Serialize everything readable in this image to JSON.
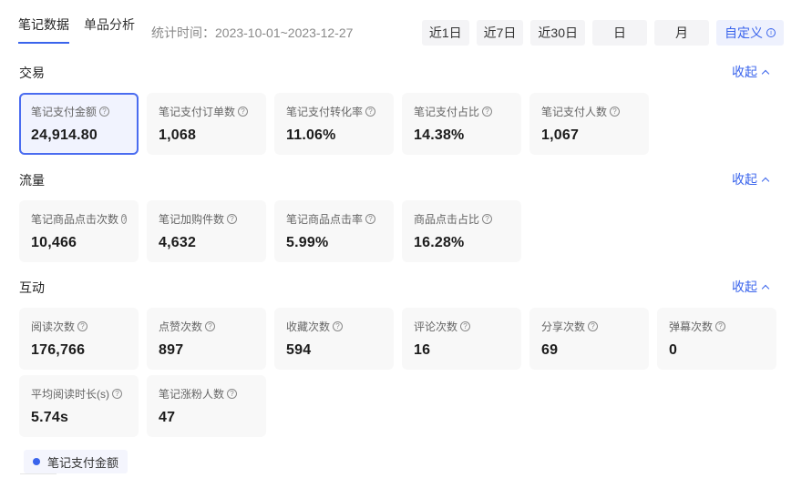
{
  "tabs": [
    {
      "label": "笔记数据",
      "active": true
    },
    {
      "label": "单品分析",
      "active": false
    }
  ],
  "stat_time": "统计时间：2023-10-01~2023-12-27",
  "range_buttons": {
    "d1": "近1日",
    "d7": "近7日",
    "d30": "近30日",
    "day": "日",
    "month": "月",
    "custom": "自定义"
  },
  "sections": {
    "trade": {
      "title": "交易",
      "collapse_label": "收起",
      "cards": [
        {
          "label": "笔记支付金额",
          "value": "24,914.80"
        },
        {
          "label": "笔记支付订单数",
          "value": "1,068"
        },
        {
          "label": "笔记支付转化率",
          "value": "11.06%"
        },
        {
          "label": "笔记支付占比",
          "value": "14.38%"
        },
        {
          "label": "笔记支付人数",
          "value": "1,067"
        }
      ]
    },
    "traffic": {
      "title": "流量",
      "collapse_label": "收起",
      "cards": [
        {
          "label": "笔记商品点击次数",
          "value": "10,466"
        },
        {
          "label": "笔记加购件数",
          "value": "4,632"
        },
        {
          "label": "笔记商品点击率",
          "value": "5.99%"
        },
        {
          "label": "商品点击占比",
          "value": "16.28%"
        }
      ]
    },
    "interaction": {
      "title": "互动",
      "collapse_label": "收起",
      "cards": [
        {
          "label": "阅读次数",
          "value": "176,766"
        },
        {
          "label": "点赞次数",
          "value": "897"
        },
        {
          "label": "收藏次数",
          "value": "594"
        },
        {
          "label": "评论次数",
          "value": "16"
        },
        {
          "label": "分享次数",
          "value": "69"
        },
        {
          "label": "弹幕次数",
          "value": "0"
        },
        {
          "label": "平均阅读时长(s)",
          "value": "5.74s"
        },
        {
          "label": "笔记涨粉人数",
          "value": "47"
        }
      ]
    }
  },
  "legend": {
    "label": "笔记支付金额",
    "color": "#3a64ec"
  },
  "accent_color": "#3a64ec"
}
